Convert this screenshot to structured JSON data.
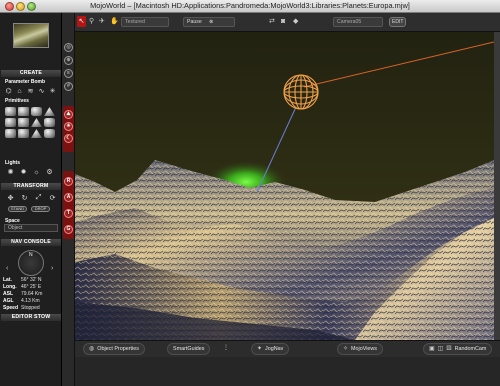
{
  "window": {
    "title": "MojoWorld – [Macintosh HD:Applications:Pandromeda:MojoWorld3:Libraries:Planets:Europa.mjw]"
  },
  "left_panel": {
    "create_header": "CREATE",
    "parameter_bomb_label": "Parameter Bomb",
    "primitives_label": "Primitives",
    "lights_label": "Lights",
    "transform_header": "TRANSFORM",
    "stand_label": "STAND",
    "drop_label": "DROP",
    "space_label": "Space",
    "space_value": "Object",
    "nav_console_header": "NAV CONSOLE",
    "compass_north": "N",
    "nav_values": [
      {
        "key": "Lat.",
        "value": "56° 32' N"
      },
      {
        "key": "Long.",
        "value": "46° 25' E"
      },
      {
        "key": "ASL",
        "value": "79.64 Km"
      },
      {
        "key": "AGL",
        "value": "4.13 Km"
      },
      {
        "key": "Speed",
        "value": "Stopped"
      }
    ],
    "editor_stow_header": "EDITOR STOW"
  },
  "top_toolbar": {
    "render_mode": "Textured",
    "pause_label": "Pause",
    "camera_label": "Camera05",
    "edit_label": "EDIT"
  },
  "side_toolbar": {
    "red_buttons": [
      "R",
      "A",
      "T",
      "G"
    ]
  },
  "bottom_bar": {
    "object_properties": "Object Properties",
    "smart_guides": "SmartGuides",
    "jognav": "JogNav",
    "mojoviews": "MojoViews",
    "random_cam": "RandomCam"
  },
  "colors": {
    "sky": "#2b2a12",
    "glow": "#4ad12a",
    "orange_line": "#d8622a",
    "blue_line": "#6b7fd6",
    "light_gizmo": "#f2a14a",
    "accent_red": "#b31414"
  },
  "icons": {
    "pointer": "arrow-icon",
    "walk": "walk-icon",
    "camera": "camera-icon",
    "pause": "pause-icon"
  }
}
